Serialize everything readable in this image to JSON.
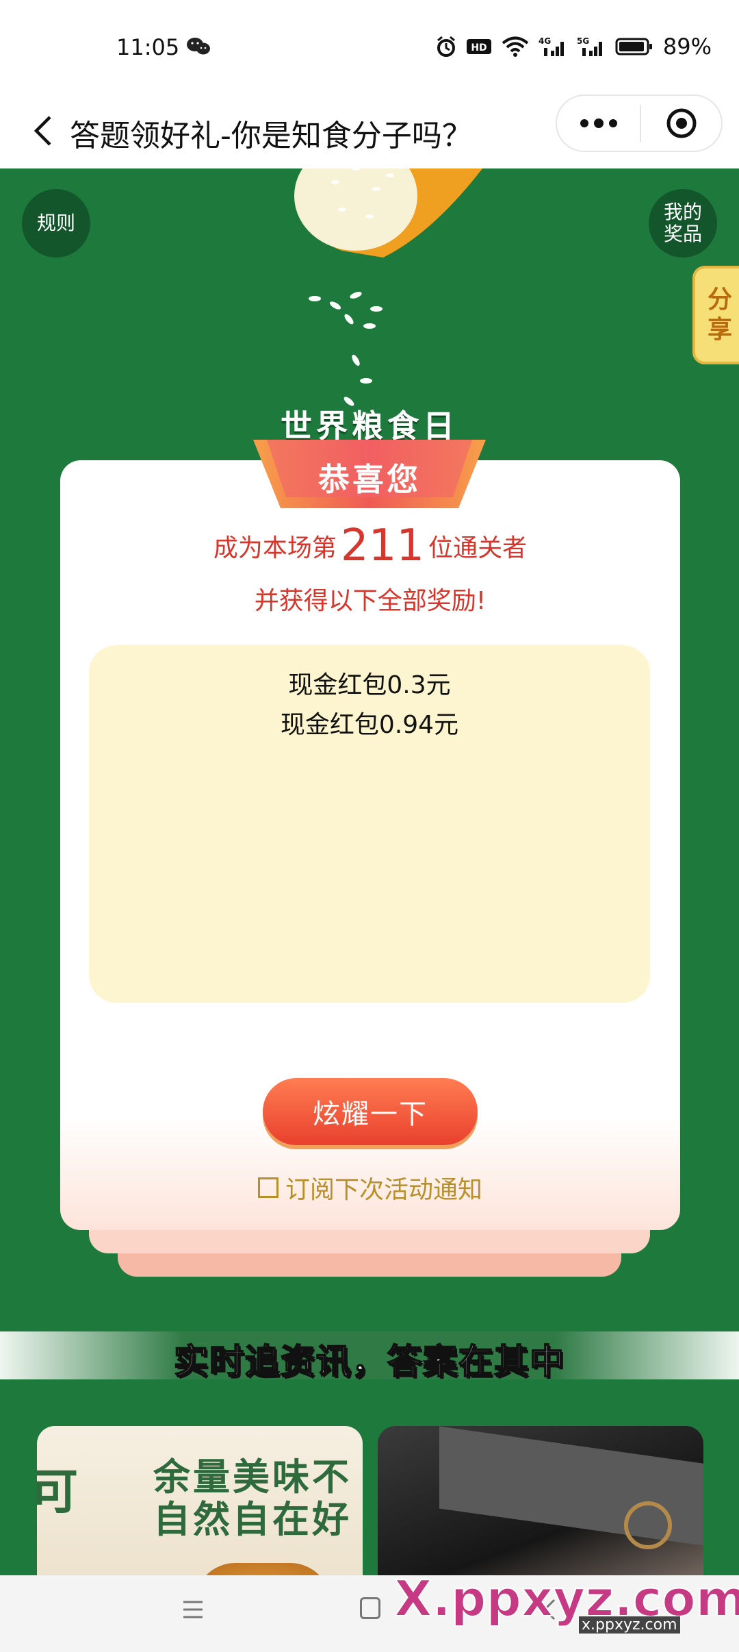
{
  "status_bar": {
    "time": "11:05",
    "battery": "89%",
    "icons": [
      "wechat-icon",
      "alarm-icon",
      "hd2-icon",
      "wifi-icon",
      "signal-4g-icon",
      "signal-5g-icon",
      "battery-icon"
    ]
  },
  "nav": {
    "title": "答题领好礼-你是知食分子吗？"
  },
  "hero": {
    "subtitle": "世界粮食日",
    "rules_label": "规则",
    "prize_label_1": "我的",
    "prize_label_2": "奖品",
    "share_label_1": "分",
    "share_label_2": "享"
  },
  "card": {
    "ribbon": "恭喜您",
    "line1_prefix": "成为本场第",
    "rank": "211",
    "line1_suffix": "位通关者",
    "line2": "并获得以下全部奖励!",
    "rewards": [
      "现金红包0.3元",
      "现金红包0.94元"
    ],
    "show_button": "炫耀一下",
    "subscribe_label": "订阅下次活动通知"
  },
  "banner": {
    "text": "实时追资讯，答案在其中"
  },
  "thumbs": {
    "left_line0": "可",
    "left_line1": "余量美味不",
    "left_line2": "自然自在好"
  },
  "watermark": {
    "main": "X.ppxyz.com",
    "sub": "x.ppxyz.com"
  },
  "colors": {
    "hero_green": "#1e7a3c",
    "accent_red": "#d6362b",
    "reward_bg": "#fdf5d0",
    "gold": "#b8902b"
  }
}
